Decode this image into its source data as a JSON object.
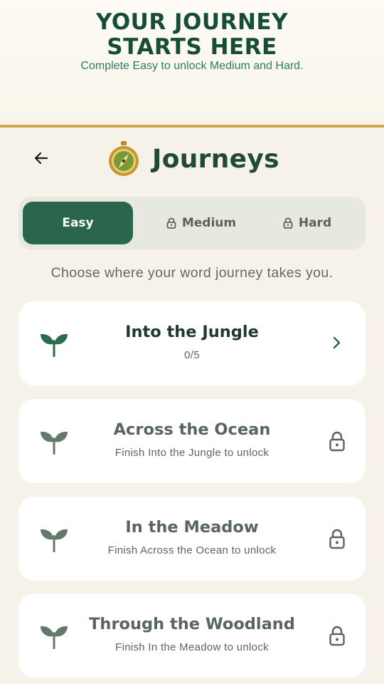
{
  "promo": {
    "title_line1": "YOUR JOURNEY",
    "title_line2": "STARTS HERE",
    "subtitle": "Complete Easy to unlock Medium and Hard."
  },
  "header": {
    "title": "Journeys",
    "back_icon": "arrow-left-icon",
    "logo_icon": "compass-icon"
  },
  "tabs": [
    {
      "label": "Easy",
      "active": true,
      "locked": false
    },
    {
      "label": "Medium",
      "active": false,
      "locked": true
    },
    {
      "label": "Hard",
      "active": false,
      "locked": true
    }
  ],
  "tagline": "Choose where your word journey takes you.",
  "journeys": [
    {
      "title": "Into the Jungle",
      "subtitle": "0/5",
      "locked": false,
      "icon": "sprout-icon"
    },
    {
      "title": "Across the Ocean",
      "subtitle": "Finish Into the Jungle to unlock",
      "locked": true,
      "icon": "sprout-icon"
    },
    {
      "title": "In the Meadow",
      "subtitle": "Finish Across the Ocean to unlock",
      "locked": true,
      "icon": "sprout-icon"
    },
    {
      "title": "Through the Woodland",
      "subtitle": "Finish In the Meadow to unlock",
      "locked": true,
      "icon": "sprout-icon"
    }
  ],
  "colors": {
    "brand_green": "#2a654d",
    "gold": "#d4a84a",
    "background": "#f6f1e9"
  }
}
